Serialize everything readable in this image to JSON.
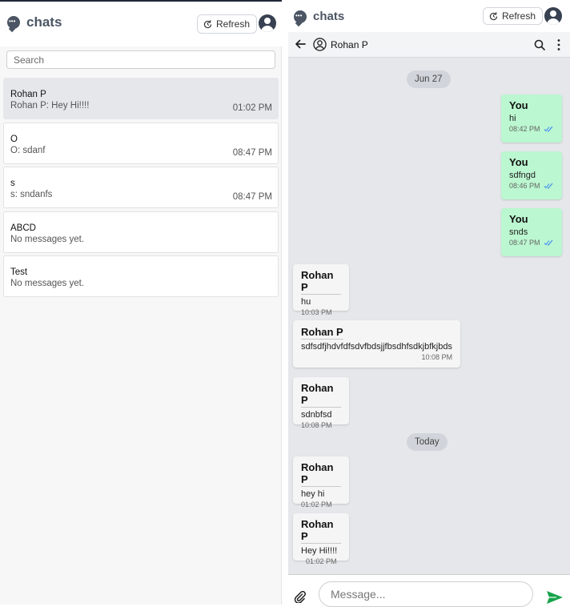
{
  "left": {
    "app_title": "chats",
    "refresh_label": "Refresh",
    "search_placeholder": "Search",
    "chats": [
      {
        "name": "Rohan P",
        "preview": "Rohan P: Hey Hi!!!!",
        "time": "01:02 PM"
      },
      {
        "name": "O",
        "preview": "O: sdanf",
        "time": "08:47 PM"
      },
      {
        "name": "s",
        "preview": "s: sndanfs",
        "time": "08:47 PM"
      },
      {
        "name": "ABCD",
        "preview": "No messages yet.",
        "time": ""
      },
      {
        "name": "Test",
        "preview": "No messages yet.",
        "time": ""
      }
    ]
  },
  "right": {
    "app_title": "chats",
    "refresh_label": "Refresh",
    "contact_name": "Rohan P",
    "date_dividers": [
      "Jun 27",
      "Today"
    ],
    "messages": [
      {
        "sender": "You",
        "text": "hi",
        "time": "08:42 PM",
        "direction": "out"
      },
      {
        "sender": "You",
        "text": "sdfngd",
        "time": "08:46 PM",
        "direction": "out"
      },
      {
        "sender": "You",
        "text": "snds",
        "time": "08:47 PM",
        "direction": "out"
      },
      {
        "sender": "Rohan P",
        "text": "hu",
        "time": "10:03 PM",
        "direction": "in"
      },
      {
        "sender": "Rohan P",
        "text": "sdfsdfjhdvfdfsdvfbdsjjfbsdhfsdkjbfkjbds",
        "time": "10:08 PM",
        "direction": "in"
      },
      {
        "sender": "Rohan P",
        "text": "sdnbfsd",
        "time": "10:08 PM",
        "direction": "in"
      },
      {
        "sender": "Rohan P",
        "text": "hey hi",
        "time": "01:02 PM",
        "direction": "in"
      },
      {
        "sender": "Rohan P",
        "text": "Hey Hi!!!!",
        "time": "01:02 PM",
        "direction": "in"
      }
    ],
    "message_placeholder": "Message..."
  },
  "colors": {
    "outgoing_bubble": "#bbf7d0",
    "incoming_bubble": "#f5f5f5",
    "send_accent": "#16a34a",
    "read_ticks": "#3b82f6"
  }
}
